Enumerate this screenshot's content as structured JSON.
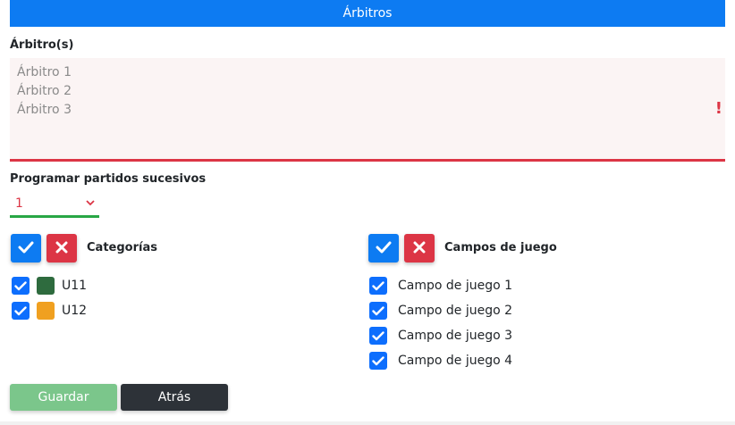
{
  "header": {
    "title": "Árbitros"
  },
  "referees": {
    "label": "Árbitro(s)",
    "lines": [
      "Árbitro 1",
      "Árbitro 2",
      "Árbitro 3"
    ],
    "warning": "!"
  },
  "schedule": {
    "label": "Programar partidos sucesivos",
    "value": "1"
  },
  "categories": {
    "title": "Categorías",
    "items": [
      {
        "label": "U11",
        "checked": true,
        "color": "#2e6b3e"
      },
      {
        "label": "U12",
        "checked": true,
        "color": "#f0a020"
      }
    ]
  },
  "fields": {
    "title": "Campos de juego",
    "items": [
      {
        "label": "Campo de juego 1",
        "checked": true
      },
      {
        "label": "Campo de juego 2",
        "checked": true
      },
      {
        "label": "Campo de juego 3",
        "checked": true
      },
      {
        "label": "Campo de juego 4",
        "checked": true
      }
    ]
  },
  "actions": {
    "save": "Guardar",
    "back": "Atrás"
  },
  "colors": {
    "primary": "#0d7bf2",
    "danger": "#dc3545",
    "success": "#28a745",
    "dark": "#2d3238"
  }
}
